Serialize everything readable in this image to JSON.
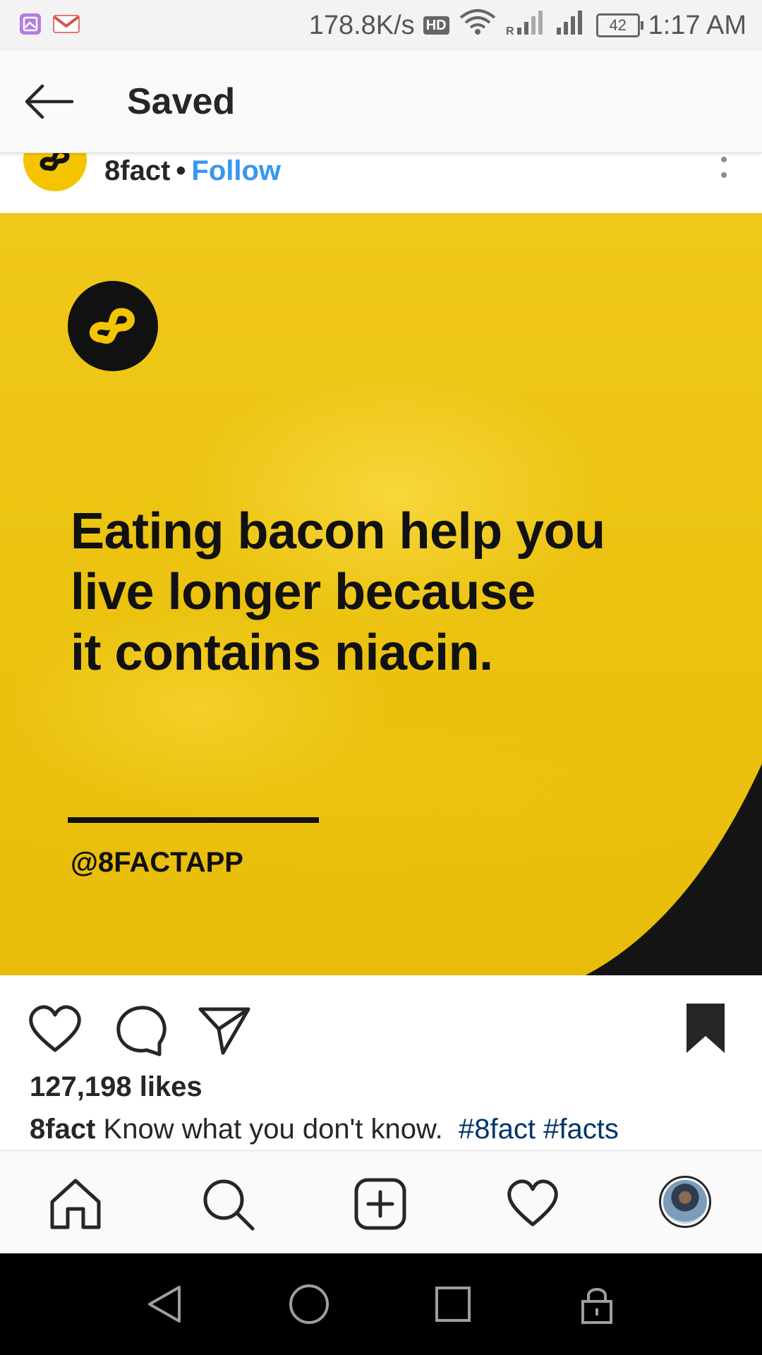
{
  "status_bar": {
    "speed": "178.8K/s",
    "hd": "HD",
    "battery": "42",
    "time": "1:17 AM"
  },
  "header": {
    "title": "Saved"
  },
  "post": {
    "username": "8fact",
    "separator": "•",
    "follow_label": "Follow",
    "image": {
      "fact_text": "Eating bacon help you\nlive longer because\nit contains niacin.",
      "handle": "@8FACTAPP",
      "background_color": "#ecc311"
    },
    "likes": "127,198 likes",
    "caption": {
      "username": "8fact",
      "text": "Know what you don't know.",
      "tags": [
        "#8fact",
        "#facts"
      ]
    },
    "bookmarked": true
  },
  "icons": {
    "status": [
      "gallery-icon",
      "gmail-icon",
      "hd-icon",
      "wifi-icon",
      "signal-icon",
      "battery-icon"
    ],
    "actions": [
      "heart-icon",
      "comment-icon",
      "share-icon",
      "bookmark-icon"
    ],
    "nav": [
      "home-icon",
      "search-icon",
      "add-post-icon",
      "activity-heart-icon",
      "profile-avatar"
    ],
    "system": [
      "back-triangle-icon",
      "home-circle-icon",
      "recents-square-icon",
      "lock-icon"
    ]
  },
  "colors": {
    "link_blue": "#3897f0",
    "hashtag": "#003569",
    "brand_yellow": "#f5c400"
  }
}
